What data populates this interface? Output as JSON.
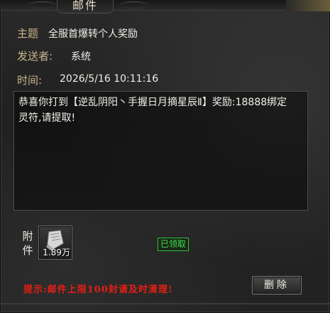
{
  "window": {
    "title": "邮件"
  },
  "mail": {
    "subject_label": "主题",
    "subject": "全服首爆转个人奖励",
    "sender_label": "发送者:",
    "sender": "系统",
    "time_label": "时间:",
    "time": "2026/5/16 10:11:16",
    "body_line1": "恭喜你打到【逆乱阴阳丶手握日月摘星辰Ⅱ】奖励:18888绑定",
    "body_line2": "灵符,请提取!"
  },
  "attachment": {
    "label_line1": "附",
    "label_line2": "件",
    "item_icon": "scroll-icon",
    "quantity": "1.89万",
    "claimed_status": "已领取"
  },
  "footer": {
    "hint": "提示:邮件上限100封请及时清理!",
    "delete_label": "删除"
  },
  "colors": {
    "hint": "#e61f14",
    "claimed": "#3fe04a",
    "label_gold": "#c9b48a"
  }
}
